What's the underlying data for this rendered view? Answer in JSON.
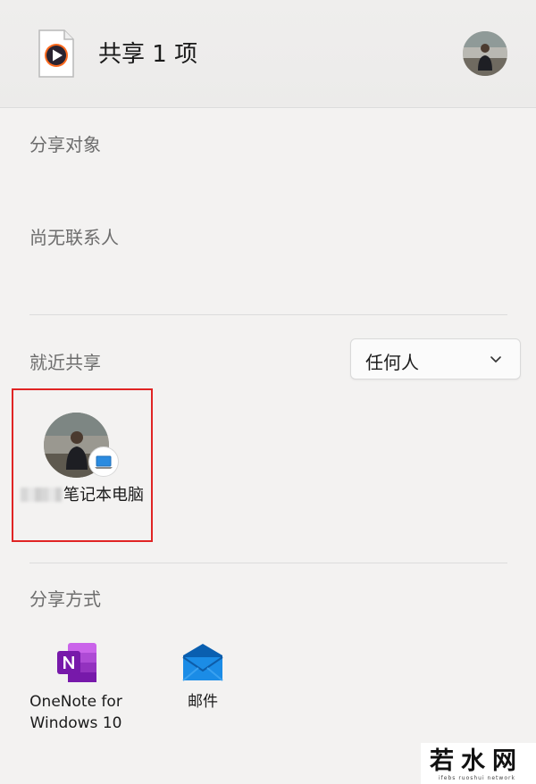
{
  "header": {
    "title": "共享 1 项",
    "file_icon": "media-player-file-icon",
    "account_avatar": "user-avatar"
  },
  "share_to": {
    "label": "分享对象",
    "empty_text": "尚无联系人"
  },
  "nearby": {
    "label": "就近共享",
    "visibility": {
      "value": "任何人",
      "icon": "chevron-down-icon"
    },
    "devices": [
      {
        "name": "笔记本电脑",
        "badge_icon": "laptop-icon"
      }
    ]
  },
  "share_with": {
    "label": "分享方式",
    "apps": [
      {
        "name": "OneNote for Windows 10",
        "icon": "onenote-icon"
      },
      {
        "name": "邮件",
        "icon": "mail-icon"
      }
    ]
  },
  "watermark": {
    "text": "若水网",
    "subtext": "ifebs  ruoshui  network"
  },
  "colors": {
    "highlight": "#e02424",
    "onenote": "#7719aa",
    "mail": "#0a78d4"
  }
}
